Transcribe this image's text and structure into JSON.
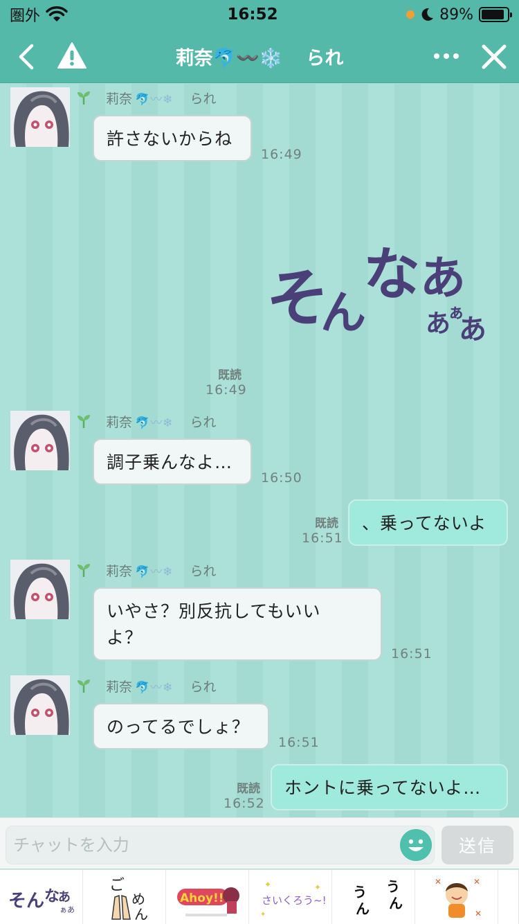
{
  "status_bar": {
    "carrier": "圏外",
    "time": "16:52",
    "battery_percent": "89%",
    "battery_level": 0.89,
    "icons": [
      "wifi-icon",
      "location-dot-icon",
      "moon-icon",
      "battery-icon"
    ]
  },
  "nav": {
    "title_name": "莉奈🐬〰️❄️",
    "title_nick": "られ",
    "icons": [
      "back-chevron-icon",
      "warning-icon",
      "more-dots-icon",
      "close-icon"
    ]
  },
  "contact": {
    "name": "莉奈",
    "emoji": "🐬〰❄",
    "nickname": "られ"
  },
  "messages": [
    {
      "type": "in",
      "text": "許さないからね",
      "time": "16:49"
    },
    {
      "type": "out_sticker",
      "sticker_text": "そんなあぁあ",
      "read": "既読",
      "time": "16:49"
    },
    {
      "type": "in",
      "text": "調子乗んなよ…",
      "time": "16:50"
    },
    {
      "type": "out",
      "text": "、乗ってないよ",
      "read": "既読",
      "time": "16:51"
    },
    {
      "type": "in",
      "text_line1": "いやさ？別反抗してもいい",
      "text_line2": "よ？",
      "time": "16:51"
    },
    {
      "type": "in",
      "text": "のってるでしょ？",
      "time": "16:51"
    },
    {
      "type": "out",
      "text": "ホントに乗ってないよ…",
      "read": "既読",
      "time": "16:52"
    }
  ],
  "input": {
    "placeholder": "チャットを入力",
    "value": "",
    "send_label": "送信"
  },
  "tray": [
    {
      "name": "sticker-sonnaa",
      "text": "そんなあぁあ"
    },
    {
      "name": "sticker-gomen",
      "text": "ごめん"
    },
    {
      "name": "sticker-ahoy",
      "text": "Ahoy!!"
    },
    {
      "name": "sticker-sainkurou",
      "text": "さいくろう~!"
    },
    {
      "name": "sticker-un-un",
      "text": "うん うん"
    },
    {
      "name": "sticker-boy",
      "text": ""
    }
  ],
  "colors": {
    "header": "#55b9a9",
    "chat_bg": "#a7ded6",
    "bubble_in": "#f1f7f7",
    "bubble_out": "#a0eadd",
    "sticker_text": "#4a3f78"
  }
}
